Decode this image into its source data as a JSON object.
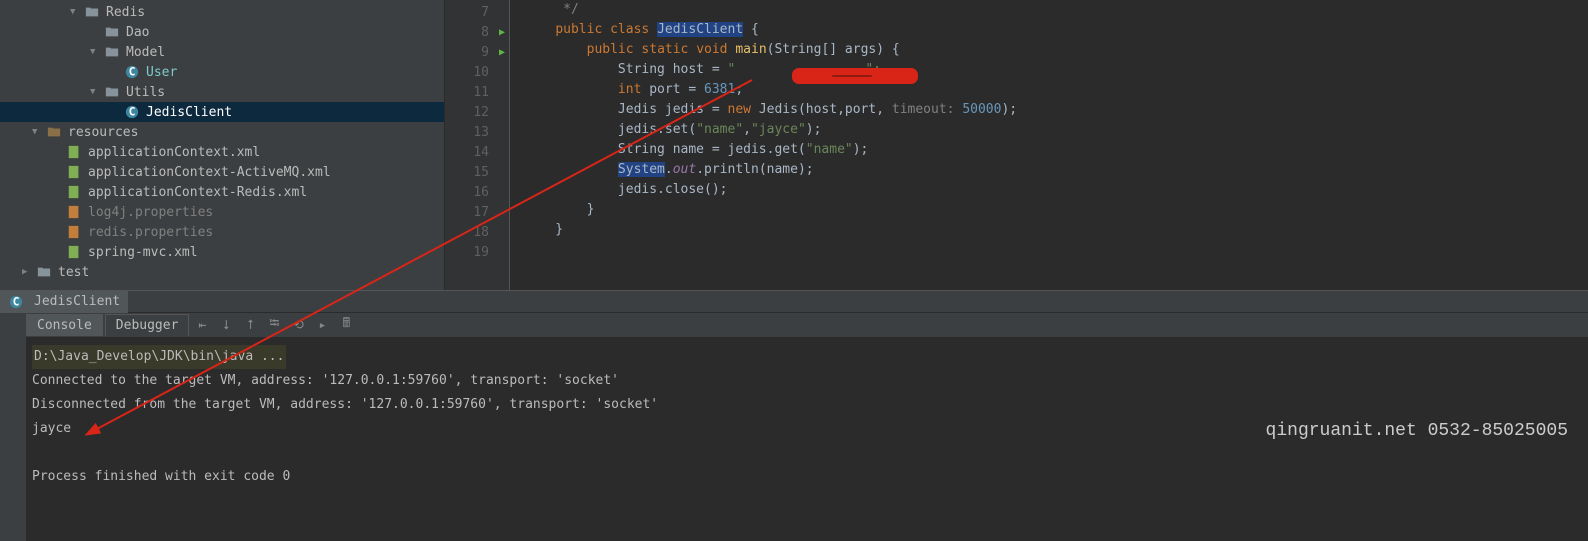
{
  "tree": {
    "redis": "Redis",
    "dao": "Dao",
    "model": "Model",
    "user": "User",
    "utils": "Utils",
    "jedisClient": "JedisClient",
    "resources": "resources",
    "appCtx": "applicationContext.xml",
    "appCtxMQ": "applicationContext-ActiveMQ.xml",
    "appCtxRedis": "applicationContext-Redis.xml",
    "log4j": "log4j.properties",
    "redisProp": "redis.properties",
    "springMvc": "spring-mvc.xml",
    "test": "test"
  },
  "editorTab": "JedisClient",
  "gutter": [
    "7",
    "8",
    "9",
    "10",
    "11",
    "12",
    "13",
    "14",
    "15",
    "16",
    "17",
    "18",
    "19"
  ],
  "code": {
    "l7": "     */",
    "l8a": "    ",
    "l8b": "public class ",
    "l8c": "JedisClient",
    "l8d": " {",
    "l9a": "        ",
    "l9b": "public static void ",
    "l9c": "main",
    "l9d": "(String[] args) {",
    "l10a": "            String host = ",
    "l10b": "\"",
    "l10c": "\";",
    "l11a": "            ",
    "l11b": "int ",
    "l11c": "port = ",
    "l11d": "6381",
    "l11e": ";",
    "l12a": "            Jedis jedis = ",
    "l12b": "new ",
    "l12c": "Jedis(host,port, ",
    "l12d": "timeout: ",
    "l12e": "50000",
    "l12f": ");",
    "l13a": "            jedis.set(",
    "l13b": "\"name\"",
    "l13c": ",",
    "l13d": "\"jayce\"",
    "l13e": ");",
    "l14a": "            String name = jedis.get(",
    "l14b": "\"name\"",
    "l14c": ");",
    "l15a": "            ",
    "l15b": "System",
    "l15c": ".",
    "l15d": "out",
    "l15e": ".println(name);",
    "l16": "            jedis.close();",
    "l17": "        }",
    "l18": "    }",
    "l19": ""
  },
  "tabs2": {
    "console": "Console",
    "debugger": "Debugger"
  },
  "output": {
    "path": "D:\\Java_Develop\\JDK\\bin\\java ...",
    "l1": "Connected to the target VM, address: '127.0.0.1:59760', transport: 'socket'",
    "l2": "Disconnected from the target VM, address: '127.0.0.1:59760', transport: 'socket'",
    "l3": "jayce",
    "l4": "Process finished with exit code 0"
  },
  "watermark": "qingruanit.net 0532-85025005"
}
